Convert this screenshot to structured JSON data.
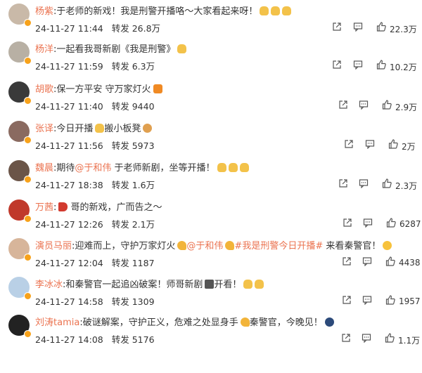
{
  "comments": [
    {
      "name": "杨紫",
      "pre": ":于老师的新戏！我是刑警开播咯～大家看起来呀！",
      "mention": "",
      "mid": "",
      "topic": "",
      "post": "",
      "emoji": [
        "hand",
        "hand",
        "hand"
      ],
      "date": "24-11-27 11:44",
      "repost": "转发 26.8万",
      "likes": "22.3万",
      "avatar_color": "#c9b9a8"
    },
    {
      "name": "杨洋",
      "pre": ":一起看我哥新剧《我是刑警》",
      "mention": "",
      "mid": "",
      "topic": "",
      "post": "",
      "emoji": [
        "hand"
      ],
      "date": "24-11-27 11:59",
      "repost": "转发 6.3万",
      "likes": "10.2万",
      "avatar_color": "#b8b0a4"
    },
    {
      "name": "胡歌",
      "pre": ":保一方平安 守万家灯火",
      "mention": "",
      "mid": "",
      "topic": "",
      "post": "",
      "emoji": [
        "orange"
      ],
      "date": "24-11-27 11:40",
      "repost": "转发 9440",
      "likes": "2.9万",
      "avatar_color": "#3a3a3a"
    },
    {
      "name": "张译",
      "pre": ":今日开播",
      "mention": "",
      "mid": "",
      "topic": "",
      "post": "搬小板凳",
      "emoji": [
        "hand"
      ],
      "emoji2": [
        "cat"
      ],
      "date": "24-11-27 11:56",
      "repost": "转发 5973",
      "likes": "2万",
      "avatar_color": "#8a6a60"
    },
    {
      "name": "魏晨",
      "pre": ":期待",
      "mention": "@于和伟",
      "mid": " 于老师新剧，坐等开播！",
      "topic": "",
      "post": "",
      "emoji": [
        "hand",
        "hand",
        "hand"
      ],
      "date": "24-11-27 18:38",
      "repost": "转发 1.6万",
      "likes": "2.3万",
      "avatar_color": "#6b5548"
    },
    {
      "name": "万茜",
      "pre": ":",
      "mention": "",
      "mid": "",
      "topic": "",
      "post": " 哥的新戏，广而告之～",
      "emojiPre": [
        "horn"
      ],
      "emoji": [],
      "date": "24-11-27 12:26",
      "repost": "转发 2.1万",
      "likes": "6287",
      "avatar_color": "#c0392b"
    },
    {
      "name": "演员马丽",
      "pre": ":迎难而上，守护万家灯火",
      "mention": "@于和伟",
      "mid": "",
      "topic": "#我是刑警今日开播#",
      "post": " 来看秦警官！",
      "emojiMid": [
        "muscle"
      ],
      "emoji": [
        "face"
      ],
      "date": "24-11-27 12:04",
      "repost": "转发 1187",
      "likes": "4438",
      "avatar_color": "#d7b59a"
    },
    {
      "name": "李冰冰",
      "pre": ":和秦警官一起追凶破案！师哥新剧",
      "mention": "",
      "mid": "",
      "topic": "",
      "post": "开看！",
      "emojiMid2": [
        "tv"
      ],
      "emoji": [
        "hand",
        "hand"
      ],
      "date": "24-11-27 14:58",
      "repost": "转发 1309",
      "likes": "1957",
      "avatar_color": "#b9d0e6"
    },
    {
      "name": "刘涛tamia",
      "pre": ":破谜解案，守护正义，危难之处显身手",
      "mention": "",
      "mid": "",
      "topic": "",
      "post": "秦警官，今晚见！",
      "emojiMid3": [
        "muscle"
      ],
      "emoji": [
        "police"
      ],
      "date": "24-11-27 14:08",
      "repost": "转发 5176",
      "likes": "1.1万",
      "avatar_color": "#222222"
    }
  ],
  "icons": {
    "share": "share-icon",
    "comment": "comment-icon",
    "like": "like-icon"
  },
  "colors": {
    "name": "#eb7350",
    "text": "#333333",
    "badge": "#f7a21b"
  }
}
